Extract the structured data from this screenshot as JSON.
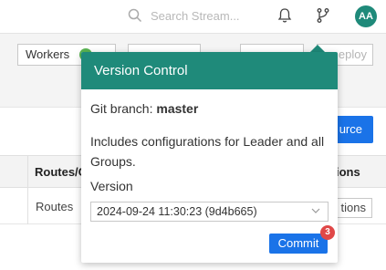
{
  "header": {
    "search_placeholder": "Search Stream...",
    "avatar_initials": "AA",
    "icons": [
      "search-icon",
      "bell-icon",
      "git-branch-icon"
    ]
  },
  "toolbar": {
    "workers_label": "Workers",
    "deploy_label": "eploy",
    "workers_status_color": "#5ab552"
  },
  "main": {
    "add_button_label": "urce",
    "columns": {
      "routes": "Routes/C",
      "actions": "ions"
    },
    "rows": [
      {
        "routes": "Routes",
        "actions_label": "tions"
      }
    ]
  },
  "version_control": {
    "title": "Version Control",
    "branch_prefix": "Git branch: ",
    "branch_name": "master",
    "description": "Includes configurations for Leader and all Groups.",
    "version_label": "Version",
    "selected_version": "2024-09-24 11:30:23 (9d4b665)",
    "commit_label": "Commit",
    "commit_badge_count": "3",
    "accent_color": "#1f8a7a"
  }
}
